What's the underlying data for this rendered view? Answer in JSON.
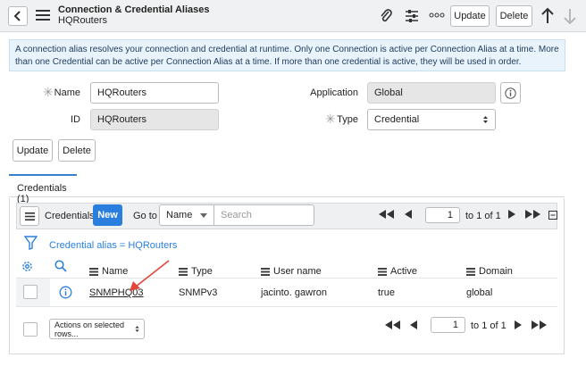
{
  "header": {
    "title": "Connection & Credential Aliases",
    "subtitle": "HQRouters",
    "update_label": "Update",
    "delete_label": "Delete"
  },
  "info_message": "A connection alias resolves your connection and credential at runtime. Only one Connection is active per Connection Alias at a time. More than one Credential can be active per Connection Alias at a time. If more than one credential is active, they will be used in order.",
  "form": {
    "name_label": "Name",
    "name_value": "HQRouters",
    "id_label": "ID",
    "id_value": "HQRouters",
    "application_label": "Application",
    "application_value": "Global",
    "type_label": "Type",
    "type_value": "Credential",
    "update_label": "Update",
    "delete_label": "Delete"
  },
  "tab": {
    "label": "Credentials (1)"
  },
  "list": {
    "title": "Credentials",
    "new_label": "New",
    "goto_label": "Go to",
    "goto_field": "Name",
    "search_placeholder": "Search",
    "page_value": "1",
    "page_info": "to 1 of 1",
    "filter_text": "Credential alias = HQRouters",
    "columns": [
      "Name",
      "Type",
      "User name",
      "Active",
      "Domain"
    ],
    "rows": [
      {
        "name": "SNMPHQ03",
        "type": "SNMPv3",
        "user_name": "jacinto. gawron",
        "active": "true",
        "domain": "global"
      }
    ],
    "actions_label": "Actions on selected rows...",
    "footer_page_value": "1",
    "footer_page_info": "to 1 of 1"
  },
  "colors": {
    "accent": "#2a7fde",
    "info_bg": "#e8f3fc",
    "arrow": "#e0463a"
  }
}
